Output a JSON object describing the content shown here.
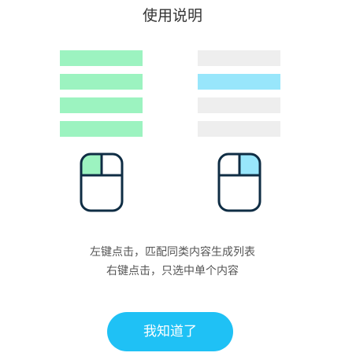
{
  "title": "使用说明",
  "instructions": {
    "left_click": "左键点击，匹配同类内容生成列表",
    "right_click": "右键点击，只选中单个内容"
  },
  "confirm_button": "我知道了",
  "colors": {
    "left_highlight": "#9cf3c0",
    "right_highlight": "#98e6fb",
    "inactive_row": "#eeeeee",
    "mouse_outline": "#0f2d44",
    "button": "#1fc1f5"
  },
  "icons": {
    "left": "mouse-left-click-icon",
    "right": "mouse-right-click-icon"
  }
}
